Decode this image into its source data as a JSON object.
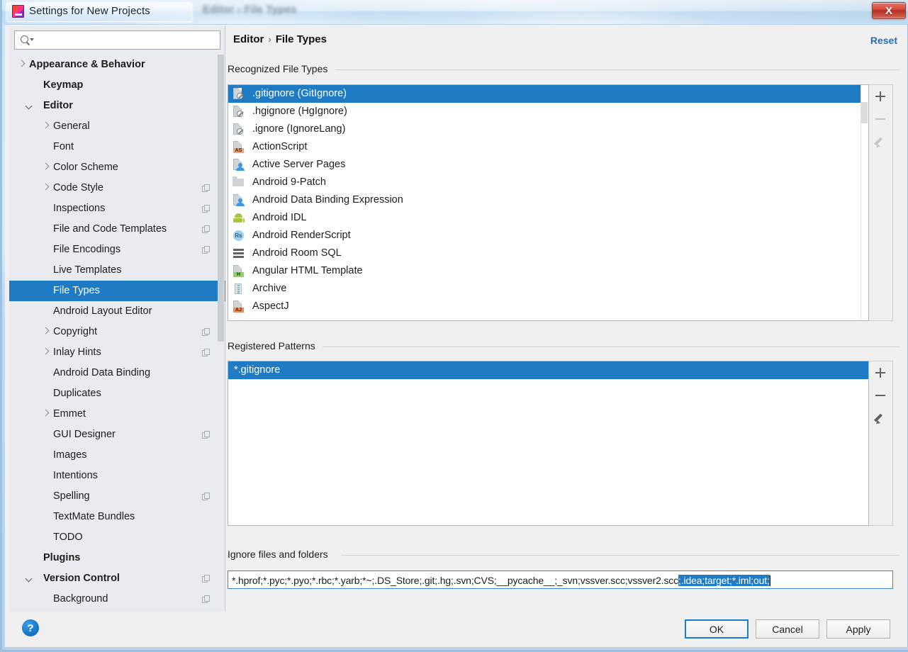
{
  "window": {
    "title": "Settings for New Projects",
    "ghost_title": "Editor  ›  File Types",
    "close_label": "X"
  },
  "sidebar": {
    "search": {
      "value": "",
      "placeholder": ""
    },
    "items": [
      {
        "label": "Appearance & Behavior",
        "indent": 28,
        "arrow": "right",
        "bold": true,
        "copy": false,
        "selected": false
      },
      {
        "label": "Keymap",
        "indent": 48,
        "arrow": "none",
        "bold": true,
        "copy": false,
        "selected": false
      },
      {
        "label": "Editor",
        "indent": 48,
        "arrow": "down",
        "bold": true,
        "copy": false,
        "selected": false,
        "arrowLeft": 24
      },
      {
        "label": "General",
        "indent": 62,
        "arrow": "right",
        "bold": false,
        "copy": false,
        "selected": false,
        "arrowLeft": 46
      },
      {
        "label": "Font",
        "indent": 62,
        "arrow": "none",
        "bold": false,
        "copy": false,
        "selected": false
      },
      {
        "label": "Color Scheme",
        "indent": 62,
        "arrow": "right",
        "bold": false,
        "copy": false,
        "selected": false,
        "arrowLeft": 46
      },
      {
        "label": "Code Style",
        "indent": 62,
        "arrow": "right",
        "bold": false,
        "copy": true,
        "selected": false,
        "arrowLeft": 46
      },
      {
        "label": "Inspections",
        "indent": 62,
        "arrow": "none",
        "bold": false,
        "copy": true,
        "selected": false
      },
      {
        "label": "File and Code Templates",
        "indent": 62,
        "arrow": "none",
        "bold": false,
        "copy": true,
        "selected": false
      },
      {
        "label": "File Encodings",
        "indent": 62,
        "arrow": "none",
        "bold": false,
        "copy": true,
        "selected": false
      },
      {
        "label": "Live Templates",
        "indent": 62,
        "arrow": "none",
        "bold": false,
        "copy": false,
        "selected": false
      },
      {
        "label": "File Types",
        "indent": 62,
        "arrow": "none",
        "bold": false,
        "copy": false,
        "selected": true
      },
      {
        "label": "Android Layout Editor",
        "indent": 62,
        "arrow": "none",
        "bold": false,
        "copy": false,
        "selected": false
      },
      {
        "label": "Copyright",
        "indent": 62,
        "arrow": "right",
        "bold": false,
        "copy": true,
        "selected": false,
        "arrowLeft": 46
      },
      {
        "label": "Inlay Hints",
        "indent": 62,
        "arrow": "right",
        "bold": false,
        "copy": true,
        "selected": false,
        "arrowLeft": 46
      },
      {
        "label": "Android Data Binding",
        "indent": 62,
        "arrow": "none",
        "bold": false,
        "copy": false,
        "selected": false
      },
      {
        "label": "Duplicates",
        "indent": 62,
        "arrow": "none",
        "bold": false,
        "copy": false,
        "selected": false
      },
      {
        "label": "Emmet",
        "indent": 62,
        "arrow": "right",
        "bold": false,
        "copy": false,
        "selected": false,
        "arrowLeft": 46
      },
      {
        "label": "GUI Designer",
        "indent": 62,
        "arrow": "none",
        "bold": false,
        "copy": true,
        "selected": false
      },
      {
        "label": "Images",
        "indent": 62,
        "arrow": "none",
        "bold": false,
        "copy": false,
        "selected": false
      },
      {
        "label": "Intentions",
        "indent": 62,
        "arrow": "none",
        "bold": false,
        "copy": false,
        "selected": false
      },
      {
        "label": "Spelling",
        "indent": 62,
        "arrow": "none",
        "bold": false,
        "copy": true,
        "selected": false
      },
      {
        "label": "TextMate Bundles",
        "indent": 62,
        "arrow": "none",
        "bold": false,
        "copy": false,
        "selected": false
      },
      {
        "label": "TODO",
        "indent": 62,
        "arrow": "none",
        "bold": false,
        "copy": false,
        "selected": false
      },
      {
        "label": "Plugins",
        "indent": 48,
        "arrow": "none",
        "bold": true,
        "copy": false,
        "selected": false
      },
      {
        "label": "Version Control",
        "indent": 48,
        "arrow": "down",
        "bold": true,
        "copy": true,
        "selected": false,
        "arrowLeft": 24
      },
      {
        "label": "Background",
        "indent": 62,
        "arrow": "none",
        "bold": false,
        "copy": true,
        "selected": false
      }
    ]
  },
  "breadcrumb": {
    "root": "Editor",
    "separator": "›",
    "leaf": "File Types"
  },
  "reset_link": "Reset",
  "recognized": {
    "section_label": "Recognized File Types",
    "items": [
      {
        "label": ".gitignore (GitIgnore)",
        "icon": "doc-ban-icon",
        "selected": true
      },
      {
        "label": ".hgignore (HgIgnore)",
        "icon": "doc-ban-icon",
        "selected": false
      },
      {
        "label": ".ignore (IgnoreLang)",
        "icon": "doc-ban-icon",
        "selected": false
      },
      {
        "label": "ActionScript",
        "icon": "doc-as-icon",
        "selected": false,
        "badge": "AS"
      },
      {
        "label": "Active Server Pages",
        "icon": "doc-person-icon",
        "selected": false
      },
      {
        "label": "Android 9-Patch",
        "icon": "folder-icon",
        "selected": false
      },
      {
        "label": "Android Data Binding Expression",
        "icon": "doc-person-icon",
        "selected": false
      },
      {
        "label": "Android IDL",
        "icon": "android-robot-icon",
        "selected": false
      },
      {
        "label": "Android RenderScript",
        "icon": "renderscript-icon",
        "selected": false,
        "badge": "Rs"
      },
      {
        "label": "Android Room SQL",
        "icon": "sql-table-icon",
        "selected": false
      },
      {
        "label": "Angular HTML Template",
        "icon": "doc-html-icon",
        "selected": false,
        "badge": "H"
      },
      {
        "label": "Archive",
        "icon": "archive-zip-icon",
        "selected": false
      },
      {
        "label": "AspectJ",
        "icon": "doc-aj-icon",
        "selected": false,
        "badge": "AJ"
      }
    ],
    "toolbar": [
      {
        "name": "add-file-type-button",
        "icon": "plus-icon",
        "enabled": true
      },
      {
        "name": "remove-file-type-button",
        "icon": "minus-icon",
        "enabled": false
      },
      {
        "name": "edit-file-type-button",
        "icon": "pencil-icon",
        "enabled": false
      }
    ]
  },
  "patterns": {
    "section_label": "Registered Patterns",
    "items": [
      {
        "label": "*.gitignore",
        "selected": true
      }
    ],
    "toolbar": [
      {
        "name": "add-pattern-button",
        "icon": "plus-icon",
        "enabled": true
      },
      {
        "name": "remove-pattern-button",
        "icon": "minus-icon",
        "enabled": true
      },
      {
        "name": "edit-pattern-button",
        "icon": "pencil-icon",
        "enabled": true
      }
    ]
  },
  "ignore": {
    "section_label": "Ignore files and folders",
    "value_unselected": "*.hprof;*.pyc;*.pyo;*.rbc;*.yarb;*~;.DS_Store;.git;.hg;.svn;CVS;__pycache__;_svn;vssver.scc;vssver2.scc",
    "value_selected": ";.idea;target;*.iml;out;",
    "full_value": "*.hprof;*.pyc;*.pyo;*.rbc;*.yarb;*~;.DS_Store;.git;.hg;.svn;CVS;__pycache__;_svn;vssver.scc;vssver2.scc;.idea;target;*.iml;out;"
  },
  "footer": {
    "help_label": "?",
    "ok_label": "OK",
    "cancel_label": "Cancel",
    "apply_label": "Apply"
  },
  "colors": {
    "selection_blue": "#1f7bc4",
    "link_blue": "#2470b3",
    "panel_bg": "#f0f0f0",
    "sidebar_bg": "#e8ecf0"
  }
}
